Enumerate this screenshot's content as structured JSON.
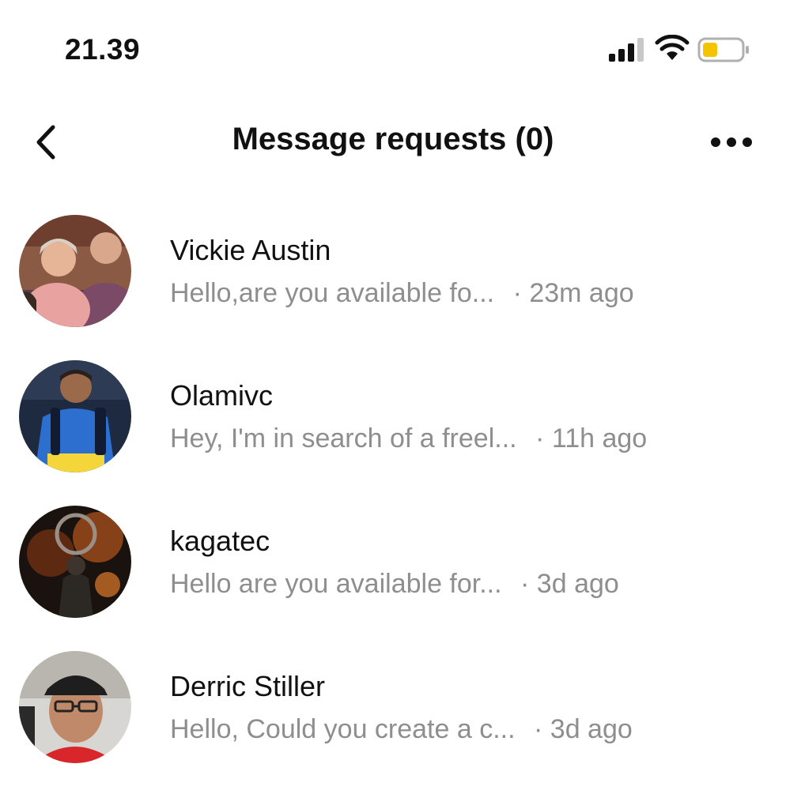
{
  "status_bar": {
    "time": "21.39",
    "icons": [
      "signal-icon",
      "wifi-icon",
      "battery-icon"
    ],
    "battery_color": "#f5c400"
  },
  "header": {
    "title": "Message requests (0)",
    "back_icon": "chevron-left-icon",
    "more_icon": "more-horizontal-icon"
  },
  "requests": [
    {
      "name": "Vickie Austin",
      "preview": "Hello,are you available fo...",
      "time": "· 23m ago",
      "avatar_icon": "avatar-photo"
    },
    {
      "name": "Olamivc",
      "preview": "Hey, I'm in search of a freel...",
      "time": "· 11h ago",
      "avatar_icon": "avatar-photo"
    },
    {
      "name": "kagatec",
      "preview": "Hello are you available for...",
      "time": "· 3d ago",
      "avatar_icon": "avatar-photo"
    },
    {
      "name": "Derric Stiller",
      "preview": "Hello, Could you create a c...",
      "time": "· 3d ago",
      "avatar_icon": "avatar-photo"
    }
  ],
  "colors": {
    "text_primary": "#111111",
    "text_secondary": "#8e8e8e",
    "background": "#ffffff"
  }
}
